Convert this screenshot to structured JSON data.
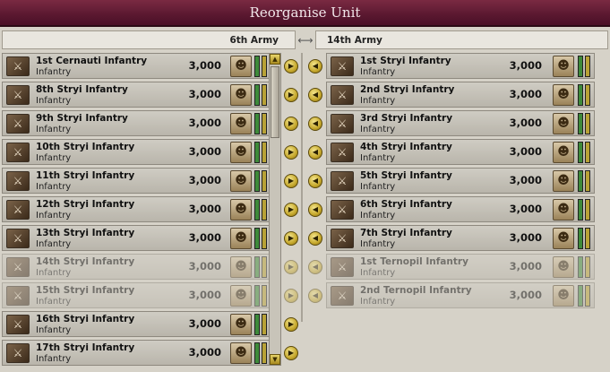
{
  "window": {
    "title": "Reorganise Unit"
  },
  "left_army": {
    "name": "6th Army",
    "units": [
      {
        "name": "1st Cernauti Infantry",
        "type": "Infantry",
        "strength": "3,000",
        "faded": false
      },
      {
        "name": "8th Stryi Infantry",
        "type": "Infantry",
        "strength": "3,000",
        "faded": false
      },
      {
        "name": "9th Stryi Infantry",
        "type": "Infantry",
        "strength": "3,000",
        "faded": false
      },
      {
        "name": "10th Stryi Infantry",
        "type": "Infantry",
        "strength": "3,000",
        "faded": false
      },
      {
        "name": "11th Stryi Infantry",
        "type": "Infantry",
        "strength": "3,000",
        "faded": false
      },
      {
        "name": "12th Stryi Infantry",
        "type": "Infantry",
        "strength": "3,000",
        "faded": false
      },
      {
        "name": "13th Stryi Infantry",
        "type": "Infantry",
        "strength": "3,000",
        "faded": false
      },
      {
        "name": "14th Stryi Infantry",
        "type": "Infantry",
        "strength": "3,000",
        "faded": true
      },
      {
        "name": "15th Stryi Infantry",
        "type": "Infantry",
        "strength": "3,000",
        "faded": true
      },
      {
        "name": "16th Stryi Infantry",
        "type": "Infantry",
        "strength": "3,000",
        "faded": false
      },
      {
        "name": "17th Stryi Infantry",
        "type": "Infantry",
        "strength": "3,000",
        "faded": false
      }
    ]
  },
  "right_army": {
    "name": "14th Army",
    "units": [
      {
        "name": "1st Stryi Infantry",
        "type": "Infantry",
        "strength": "3,000",
        "faded": false
      },
      {
        "name": "2nd Stryi Infantry",
        "type": "Infantry",
        "strength": "3,000",
        "faded": false
      },
      {
        "name": "3rd Stryi Infantry",
        "type": "Infantry",
        "strength": "3,000",
        "faded": false
      },
      {
        "name": "4th Stryi Infantry",
        "type": "Infantry",
        "strength": "3,000",
        "faded": false
      },
      {
        "name": "5th Stryi Infantry",
        "type": "Infantry",
        "strength": "3,000",
        "faded": false
      },
      {
        "name": "6th Stryi Infantry",
        "type": "Infantry",
        "strength": "3,000",
        "faded": false
      },
      {
        "name": "7th Stryi Infantry",
        "type": "Infantry",
        "strength": "3,000",
        "faded": false
      },
      {
        "name": "1st Ternopil Infantry",
        "type": "Infantry",
        "strength": "3,000",
        "faded": true
      },
      {
        "name": "2nd Ternopil Infantry",
        "type": "Infantry",
        "strength": "3,000",
        "faded": true
      }
    ]
  },
  "controls": {
    "swap_glyph": "⟷",
    "move_right_glyph": "▶",
    "move_left_glyph": "◀",
    "scroll_up_glyph": "▲",
    "scroll_down_glyph": "▼"
  },
  "colors": {
    "title_bar": "#5a1830",
    "strength_bar": "#3e8a3a",
    "organisation_bar": "#b8a236"
  }
}
